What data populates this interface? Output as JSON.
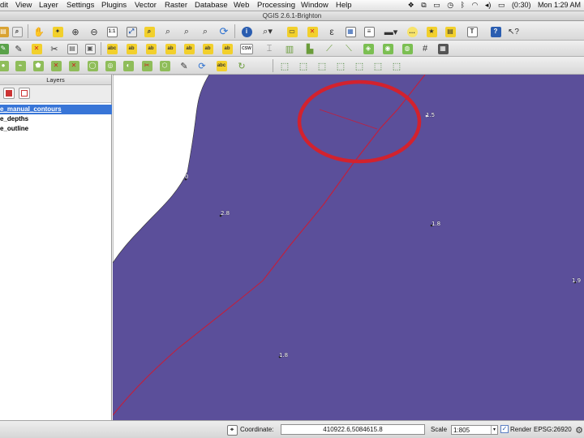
{
  "menubar": {
    "items": [
      "dit",
      "View",
      "Layer",
      "Settings",
      "Plugins",
      "Vector",
      "Raster",
      "Database",
      "Web",
      "Processing",
      "Window",
      "Help"
    ],
    "battery": "(0:30)",
    "clock": "Mon 1:29 AM"
  },
  "window": {
    "title": "QGIS 2.6.1-Brighton"
  },
  "layers_panel": {
    "title": "Layers",
    "layers": [
      {
        "name": "e_manual_contours",
        "selected": true
      },
      {
        "name": "e_depths",
        "selected": false
      },
      {
        "name": "e_outline",
        "selected": false
      }
    ]
  },
  "map": {
    "background_color": "#5b4f9a",
    "land_color": "#ffffff",
    "line_color": "#c41e3a",
    "highlight_circle_color": "#d2222e",
    "depth_labels": [
      "1.5",
      "0",
      "2.8",
      "1.8",
      "1.9",
      "1.8"
    ]
  },
  "toolbar": {
    "csw_label": "CSW"
  },
  "statusbar": {
    "coordinate_label": "Coordinate:",
    "coordinate_value": "410922.6,5084615.8",
    "scale_label": "Scale",
    "scale_value": "1:805",
    "render_label": "Render",
    "render_checked": true,
    "crs": "EPSG:26920"
  }
}
